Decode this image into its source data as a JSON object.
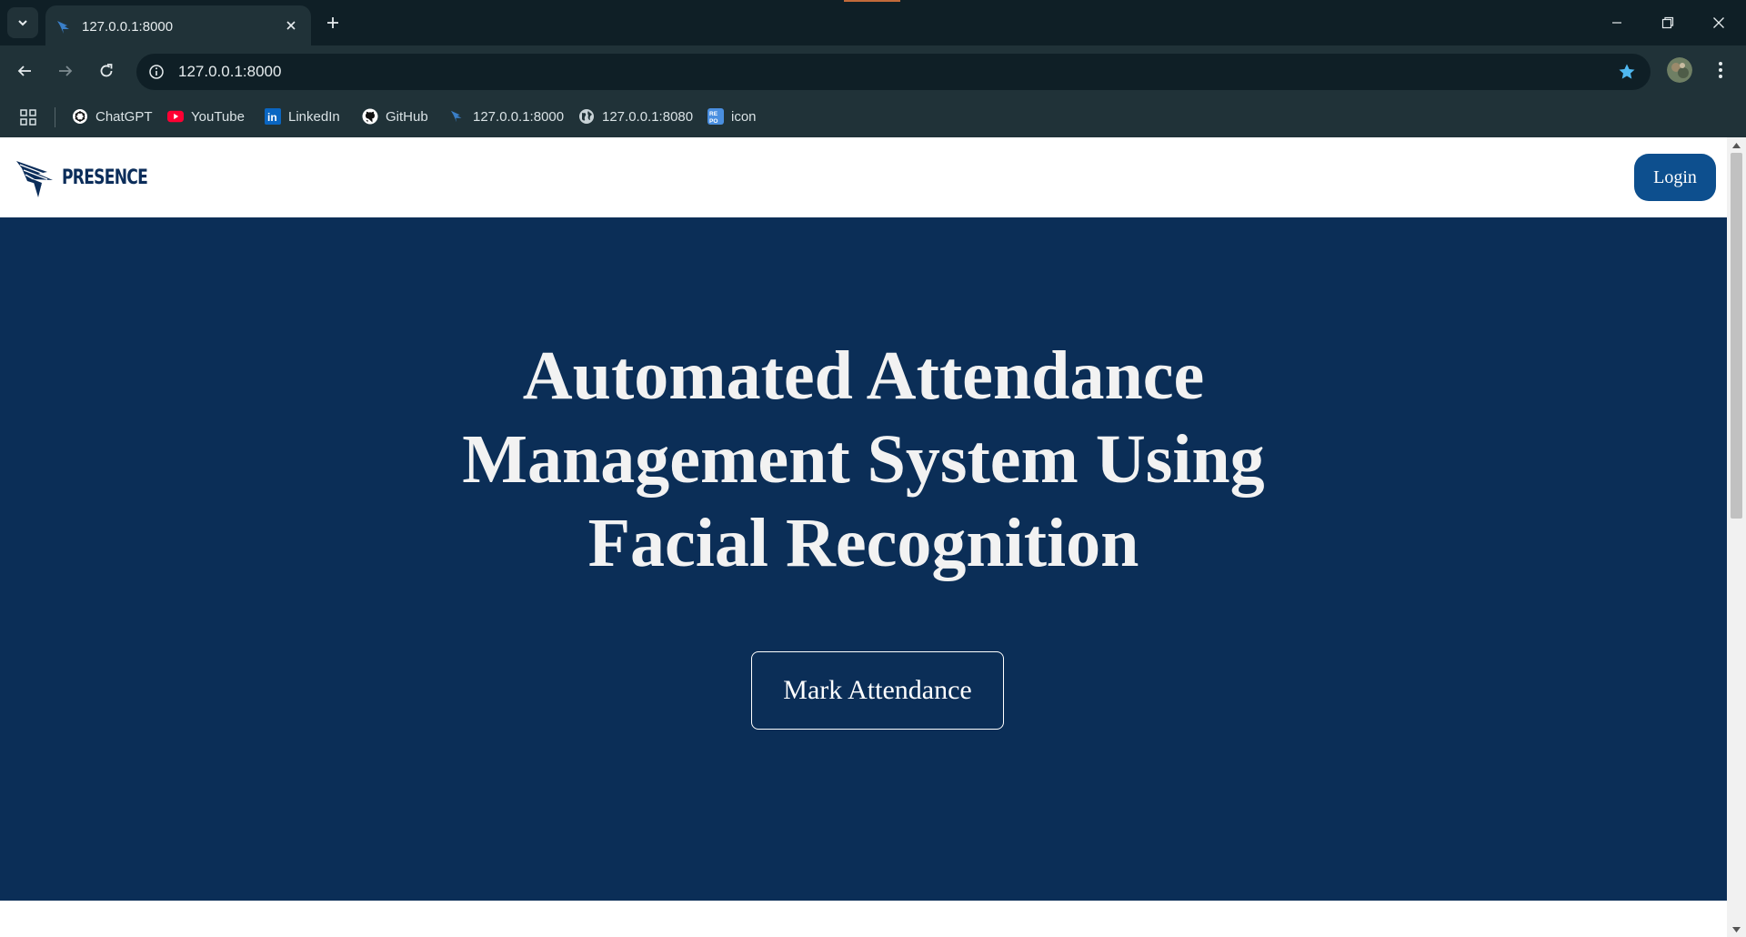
{
  "browser": {
    "tab": {
      "title": "127.0.0.1:8000"
    },
    "address_bar": {
      "url": "127.0.0.1:8000"
    },
    "bookmarks": [
      {
        "label": "ChatGPT",
        "icon": "chatgpt-icon"
      },
      {
        "label": "YouTube",
        "icon": "youtube-icon"
      },
      {
        "label": "LinkedIn",
        "icon": "linkedin-icon"
      },
      {
        "label": "GitHub",
        "icon": "github-icon"
      },
      {
        "label": "127.0.0.1:8000",
        "icon": "presence-favicon-icon"
      },
      {
        "label": "127.0.0.1:8080",
        "icon": "globe-icon"
      },
      {
        "label": "icon",
        "icon": "repo-icon"
      }
    ],
    "colors": {
      "tabbar": "#0f1f26",
      "toolbar": "#203238",
      "star": "#4fb8f0"
    }
  },
  "site": {
    "logo_text": "PRESENCE",
    "login_label": "Login",
    "hero": {
      "title_lines": [
        "Automated Attendance",
        "Management System Using",
        "Facial Recognition"
      ],
      "cta_label": "Mark Attendance"
    },
    "colors": {
      "hero_bg": "#0b2e57",
      "login_bg": "#0d4f8e",
      "logo": "#0b2d5a"
    }
  }
}
